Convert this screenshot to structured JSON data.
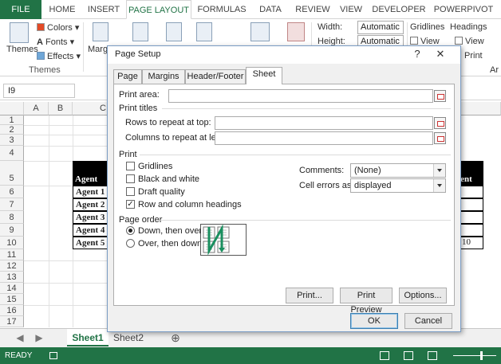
{
  "ribbon": {
    "tabs": [
      "FILE",
      "HOME",
      "INSERT",
      "PAGE LAYOUT",
      "FORMULAS",
      "DATA",
      "REVIEW",
      "VIEW",
      "DEVELOPER",
      "POWERPIVOT"
    ],
    "active_tab": "PAGE LAYOUT",
    "themes_label": "Themes",
    "colors_label": "Colors",
    "fonts_label": "Fonts",
    "effects_label": "Effects",
    "themes_group": "Themes",
    "margins_label": "Marg",
    "width_label": "Width:",
    "width_value": "Automatic",
    "height_label": "Height:",
    "height_value": "Automatic",
    "gridlines_label": "Gridlines",
    "headings_label": "Headings",
    "view_label": "View",
    "print_label": "Print",
    "arrange_label": "Ar"
  },
  "formula_bar": {
    "name_box": "I9"
  },
  "grid": {
    "columns": [
      "A",
      "B",
      "C"
    ],
    "rows": [
      "1",
      "2",
      "3",
      "4",
      "5",
      "6",
      "7",
      "8",
      "9",
      "10",
      "11",
      "12",
      "13",
      "14",
      "15",
      "16",
      "17"
    ],
    "agent_header": "Agent",
    "agent_cells": [
      "Agent 1",
      "Agent 2",
      "Agent 3",
      "Agent 4",
      "Agent 5"
    ],
    "right_header": "ment",
    "right_value": "10"
  },
  "sheets": {
    "tabs": [
      "Sheet1",
      "Sheet2"
    ],
    "active": "Sheet1"
  },
  "status": {
    "ready": "READY"
  },
  "dialog": {
    "title": "Page Setup",
    "help": "?",
    "close": "✕",
    "tabs": [
      "Page",
      "Margins",
      "Header/Footer",
      "Sheet"
    ],
    "active_tab": "Sheet",
    "print_area_label": "Print area:",
    "print_titles_label": "Print titles",
    "rows_repeat_label": "Rows to repeat at top:",
    "cols_repeat_label": "Columns to repeat at left:",
    "print_section_label": "Print",
    "gridlines_label": "Gridlines",
    "black_white_label": "Black and white",
    "draft_label": "Draft quality",
    "row_col_headings_label": "Row and column headings",
    "row_col_headings_checked": "✓",
    "comments_label": "Comments:",
    "comments_value": "(None)",
    "cell_errors_label": "Cell errors as:",
    "cell_errors_value": "displayed",
    "page_order_label": "Page order",
    "down_over_label": "Down, then over",
    "over_down_label": "Over, then down",
    "print_button": "Print...",
    "preview_button": "Print Preview",
    "options_button": "Options...",
    "ok_button": "OK",
    "cancel_button": "Cancel"
  }
}
